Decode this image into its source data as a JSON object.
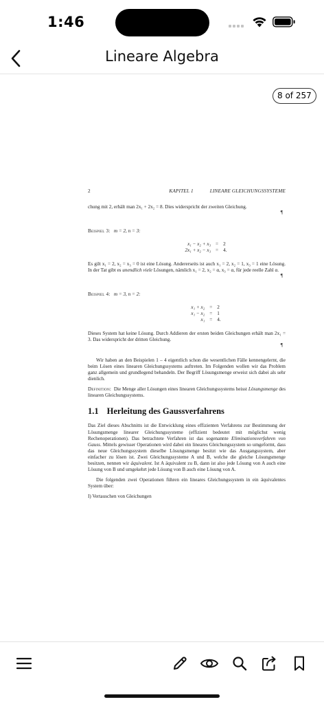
{
  "status_bar": {
    "time": "1:46"
  },
  "nav": {
    "title": "Lineare Algebra"
  },
  "viewer": {
    "page_counter": "8 of 257"
  },
  "document": {
    "page_number": "2",
    "chapter": "KAPITEL 1",
    "chapter_title": "LINEARE GLEICHUNGSSYSTEME",
    "p_intro": "chung mit 2, erhält man 2x₁ + 2x₂ = 8. Dies widerspricht der zweiten Gleichung.",
    "pilcrow": "¶",
    "ex3_label": "Beispiel 3:",
    "ex3_params": "m = 2, n = 3:",
    "ex3_eq": [
      {
        "lhs": "x₁ − x₂ + x₃",
        "rel": "=",
        "rhs": "2"
      },
      {
        "lhs": "2x₁ + x₂ − x₃",
        "rel": "=",
        "rhs": "4."
      }
    ],
    "ex3_text_1": "Es gilt x₁ = 2, x₂ = x₃ = 0 ist eine Lösung. Andererseits ist auch x₁ = 2, x₂ = 1, x₃ = 1 eine Lösung. In der Tat gibt es ",
    "ex3_text_em": "unendlich viele",
    "ex3_text_2": " Lösungen, nämlich x₁ = 2, x₂ = α, x₃ = α, für jede reelle Zahl α.",
    "ex4_label": "Beispiel 4:",
    "ex4_params": "m = 3, n = 2:",
    "ex4_eq": [
      {
        "lhs": "x₁ + x₂",
        "rel": "=",
        "rhs": "2"
      },
      {
        "lhs": "x₁ − x₂",
        "rel": "=",
        "rhs": "1"
      },
      {
        "lhs": "x₁",
        "rel": "=",
        "rhs": "4."
      }
    ],
    "ex4_text": "Dieses System hat keine Lösung. Durch Addieren der ersten beiden Gleichungen erhält man 2x₁ = 3. Das widerspricht der dritten Gleichung.",
    "p_summary": "Wir haben an den Beispielen 1 – 4 eigentlich schon die wesentlichen Fälle kennengelernt, die beim Lösen eines linearen Gleichungssystems auftreten. Im Folgenden wollen wir das Problem ganz allgemein und grundlegend behandeln. Der Begriff Lösungsmenge erweist sich dabei als sehr dienlich.",
    "def_label": "Definition:",
    "def_text_1": "Die Menge aller Lösungen eines linearen Gleichungssystems heisst ",
    "def_text_em": "Lösungsmenge",
    "def_text_2": " des linearen Gleichungssystems.",
    "section_number": "1.1",
    "section_title": "Herleitung des Gaussverfahrens",
    "p_sec_1": "Das Ziel dieses Abschnitts ist die Entwicklung eines effizienten Verfahrens zur Bestimmung der Lösungsmenge linearer Gleichungssysteme (effizient bedeutet mit möglichst wenig Rechenoperationen). Das betrachtete Verfahren ist das sogenannte ",
    "p_sec_em1": "Eliminationsverfahren von Gauss",
    "p_sec_2": ". Mittels gewisser Operationen wird dabei ein lineares Gleichungssystem so umgeformt, dass das neue Gleichungssystem dieselbe Lösungsmenge besitzt wie das Ausgangssystem, aber einfacher zu lösen ist. Zwei Gleichungssysteme A und B, welche die gleiche Lösungsmenge besitzen, nennen wir ",
    "p_sec_em2": "äquivalent",
    "p_sec_3": ". Ist A äquivalent zu B, dann ist also jede Lösung von A auch eine Lösung von B und umgekehrt jede Lösung von B auch eine Lösung von A.",
    "p_ops": "Die folgenden zwei Operationen führen ein lineares Gleichungssystem in ein äquivalentes System über:",
    "op_1": "I) Vertauschen von Gleichungen"
  },
  "toolbar": {
    "icons": [
      "menu-icon",
      "pencil-icon",
      "eye-icon",
      "search-icon",
      "share-icon",
      "bookmark-icon"
    ]
  }
}
